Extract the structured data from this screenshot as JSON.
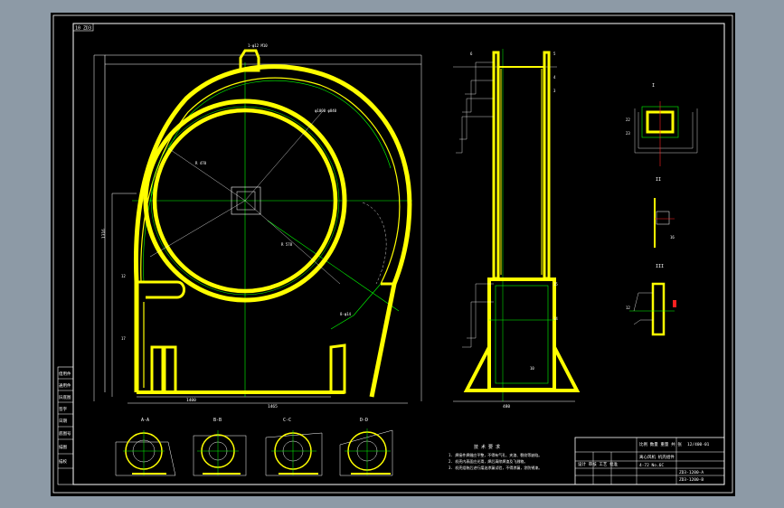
{
  "drawing": {
    "corner_tag": "10 ZD3",
    "title_block": {
      "scale_row": "比例 数量 重量 共 张",
      "part_number": "12/400-01",
      "name_row_1": "离心风机 机壳组件",
      "name_row_2": "4-72 No.6C",
      "company": "设计 审核 工艺 批准",
      "drawing_no": "ZD3-1200-A",
      "drawing_no_2": "ZD3-1200-B"
    },
    "left_stamp": [
      "借用件",
      "通用件",
      "旧底图",
      "签字",
      "日期",
      "底图号",
      "描图",
      "描校"
    ],
    "notes_heading": "技 术 要 求",
    "notes": [
      "1. 焊接件焊缝应平整，不得有气孔、夹渣、裂纹等缺陷。",
      "2. 机壳内表面应光滑，焊后清除焊渣及飞溅物。",
      "3. 机壳组装后进行煤油渗漏试验，不得渗漏，涂防锈漆。"
    ],
    "section_labels": [
      "A-A",
      "B-B",
      "C-C",
      "D-D"
    ],
    "view_labels": [
      "I",
      "II",
      "III"
    ],
    "dims": {
      "base_width": "1465",
      "sub_width": "1400",
      "height_total": "1316",
      "side_width": "480"
    }
  }
}
